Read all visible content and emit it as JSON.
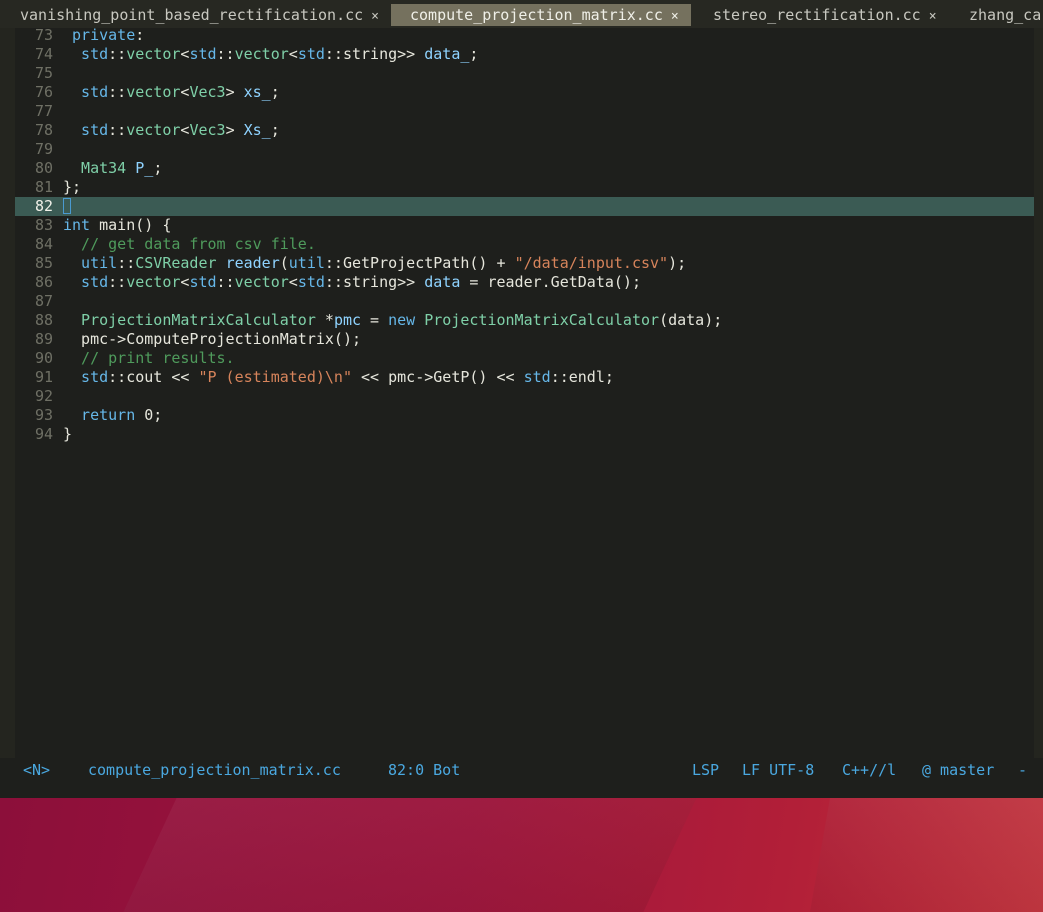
{
  "tabs": [
    {
      "label": "vanishing_point_based_rectification.cc",
      "close": "×"
    },
    {
      "label": "compute_projection_matrix.cc",
      "close": "×"
    },
    {
      "label": "stereo_rectification.cc",
      "close": "×"
    },
    {
      "label": "zhang_ca",
      "close": ""
    }
  ],
  "lines": [
    {
      "n": "73",
      "t": [
        [
          "kw",
          " private"
        ],
        [
          "pl",
          ":"
        ]
      ]
    },
    {
      "n": "74",
      "t": [
        [
          "ns",
          "  std"
        ],
        [
          "pl",
          "::"
        ],
        [
          "ty",
          "vector"
        ],
        [
          "pl",
          "<"
        ],
        [
          "ns",
          "std"
        ],
        [
          "pl",
          "::"
        ],
        [
          "ty",
          "vector"
        ],
        [
          "pl",
          "<"
        ],
        [
          "ns",
          "std"
        ],
        [
          "pl",
          "::"
        ],
        [
          "pl",
          "string>> "
        ],
        [
          "var",
          "data_"
        ],
        [
          "pl",
          ";"
        ]
      ]
    },
    {
      "n": "75",
      "t": []
    },
    {
      "n": "76",
      "t": [
        [
          "ns",
          "  std"
        ],
        [
          "pl",
          "::"
        ],
        [
          "ty",
          "vector"
        ],
        [
          "pl",
          "<"
        ],
        [
          "ty",
          "Vec3"
        ],
        [
          "pl",
          "> "
        ],
        [
          "var",
          "xs_"
        ],
        [
          "pl",
          ";"
        ]
      ]
    },
    {
      "n": "77",
      "t": []
    },
    {
      "n": "78",
      "t": [
        [
          "ns",
          "  std"
        ],
        [
          "pl",
          "::"
        ],
        [
          "ty",
          "vector"
        ],
        [
          "pl",
          "<"
        ],
        [
          "ty",
          "Vec3"
        ],
        [
          "pl",
          "> "
        ],
        [
          "var",
          "Xs_"
        ],
        [
          "pl",
          ";"
        ]
      ]
    },
    {
      "n": "79",
      "t": []
    },
    {
      "n": "80",
      "t": [
        [
          "ty",
          "  Mat34 "
        ],
        [
          "var",
          "P_"
        ],
        [
          "pl",
          ";"
        ]
      ]
    },
    {
      "n": "81",
      "t": [
        [
          "pl",
          "};"
        ]
      ]
    },
    {
      "n": "82",
      "t": [],
      "current": true
    },
    {
      "n": "83",
      "t": [
        [
          "kw",
          "int"
        ],
        [
          "pl",
          " main() {"
        ]
      ]
    },
    {
      "n": "84",
      "t": [
        [
          "cm",
          "  // get data from csv file."
        ]
      ]
    },
    {
      "n": "85",
      "t": [
        [
          "ns",
          "  util"
        ],
        [
          "pl",
          "::"
        ],
        [
          "ty",
          "CSVReader"
        ],
        [
          "pl",
          " "
        ],
        [
          "var",
          "reader"
        ],
        [
          "pl",
          "("
        ],
        [
          "ns",
          "util"
        ],
        [
          "pl",
          "::GetProjectPath() + "
        ],
        [
          "str",
          "\"/data/input.csv\""
        ],
        [
          "pl",
          ");"
        ]
      ]
    },
    {
      "n": "86",
      "t": [
        [
          "ns",
          "  std"
        ],
        [
          "pl",
          "::"
        ],
        [
          "ty",
          "vector"
        ],
        [
          "pl",
          "<"
        ],
        [
          "ns",
          "std"
        ],
        [
          "pl",
          "::"
        ],
        [
          "ty",
          "vector"
        ],
        [
          "pl",
          "<"
        ],
        [
          "ns",
          "std"
        ],
        [
          "pl",
          "::"
        ],
        [
          "pl",
          "string>> "
        ],
        [
          "var",
          "data"
        ],
        [
          "pl",
          " = reader.GetData();"
        ]
      ]
    },
    {
      "n": "87",
      "t": []
    },
    {
      "n": "88",
      "t": [
        [
          "ty",
          "  ProjectionMatrixCalculator"
        ],
        [
          "pl",
          " *"
        ],
        [
          "var",
          "pmc"
        ],
        [
          "pl",
          " = "
        ],
        [
          "kw",
          "new"
        ],
        [
          "pl",
          " "
        ],
        [
          "ty",
          "ProjectionMatrixCalculator"
        ],
        [
          "pl",
          "(data);"
        ]
      ]
    },
    {
      "n": "89",
      "t": [
        [
          "pl",
          "  pmc->ComputeProjectionMatrix();"
        ]
      ]
    },
    {
      "n": "90",
      "t": [
        [
          "cm",
          "  // print results."
        ]
      ]
    },
    {
      "n": "91",
      "t": [
        [
          "ns",
          "  std"
        ],
        [
          "pl",
          "::cout << "
        ],
        [
          "str",
          "\"P (estimated)\\n\""
        ],
        [
          "pl",
          " << pmc->GetP() << "
        ],
        [
          "ns",
          "std"
        ],
        [
          "pl",
          "::endl;"
        ]
      ]
    },
    {
      "n": "92",
      "t": []
    },
    {
      "n": "93",
      "t": [
        [
          "kw",
          "  return"
        ],
        [
          "pl",
          " 0;"
        ]
      ]
    },
    {
      "n": "94",
      "t": [
        [
          "pl",
          "}"
        ]
      ]
    }
  ],
  "status": {
    "mode": "<N>",
    "filename": "compute_projection_matrix.cc",
    "position": "82:0 Bot",
    "lsp": "LSP",
    "encoding": "LF UTF-8",
    "filetype": "C++//l",
    "branch": "@ master",
    "tail": "-"
  },
  "colors": {
    "editor_bg": "#1e1f1c",
    "current_line": "#3b5b54",
    "status_text": "#4aa8e0",
    "active_tab": "#75715e"
  }
}
